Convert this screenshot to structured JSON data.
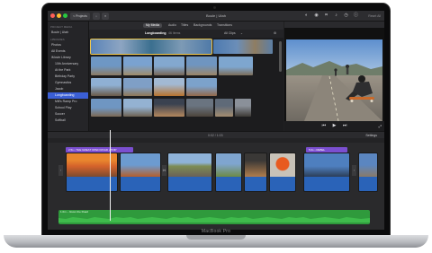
{
  "device": {
    "brand": "MacBook Pro"
  },
  "window": {
    "back_label": "< Projects",
    "title": "Boule | Utah",
    "toolbar_icons": [
      "camera-icon",
      "color-icon",
      "crop-icon",
      "audio-icon",
      "speed-icon",
      "info-icon"
    ],
    "reset_label": "Reset All"
  },
  "library": {
    "section_label": "PROJECT MEDIA",
    "project": "Boule | Utah",
    "libraries_label": "LIBRARIES",
    "items": [
      {
        "label": "Photos",
        "selected": false,
        "top": true
      },
      {
        "label": "All Events",
        "selected": false,
        "top": true
      },
      {
        "label": "iMovie Library",
        "selected": false,
        "top": true
      },
      {
        "label": "10th Anniversary",
        "selected": false
      },
      {
        "label": "At the Park",
        "selected": false
      },
      {
        "label": "Birthday Party",
        "selected": false
      },
      {
        "label": "Gymnastics",
        "selected": false
      },
      {
        "label": "Jacob",
        "selected": false
      },
      {
        "label": "Longboarding",
        "selected": true
      },
      {
        "label": "Mill's Ramp Pro",
        "selected": false
      },
      {
        "label": "School Play",
        "selected": false
      },
      {
        "label": "Soccer",
        "selected": false
      },
      {
        "label": "Softball",
        "selected": false
      }
    ]
  },
  "browser": {
    "tabs": [
      "My Media",
      "Audio",
      "Titles",
      "Backgrounds",
      "Transitions"
    ],
    "active_tab": "My Media",
    "event_name": "Longboarding",
    "count": "46 Items",
    "filter": "All Clips"
  },
  "timeline": {
    "timecode": "0:02 / 1:03",
    "settings_label": "Settings",
    "titles": [
      "2.5s • THE GREAT OPEN ROAD • TRIP",
      "5.0s • REBEL"
    ],
    "music_label": "1.0m – Given the Road"
  },
  "colors": {
    "accent": "#3b5fd6",
    "title_clip": "#7b4fd0",
    "audio_wave": "#2a63b8",
    "music": "#2f9a3c",
    "selection": "#f2c94c"
  }
}
